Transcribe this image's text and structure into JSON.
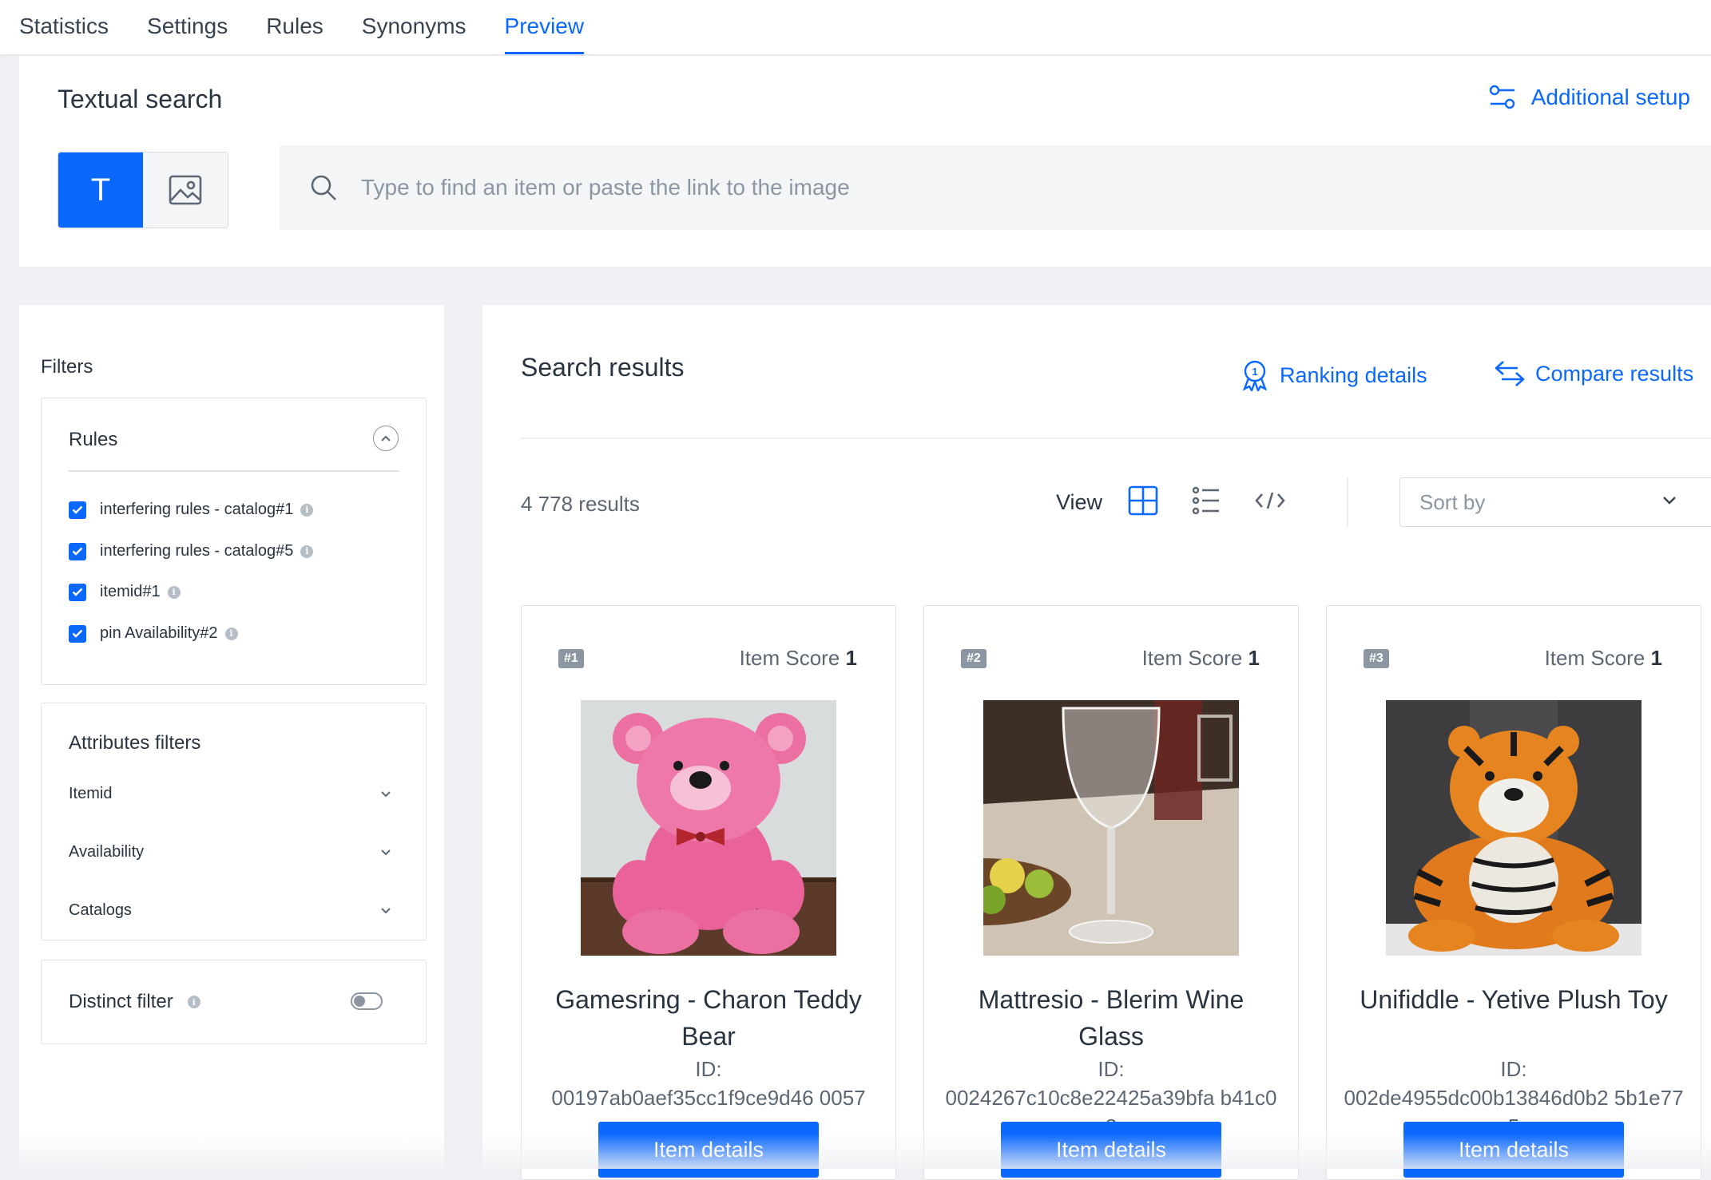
{
  "tabs": [
    {
      "label": "Statistics"
    },
    {
      "label": "Settings"
    },
    {
      "label": "Rules"
    },
    {
      "label": "Synonyms"
    },
    {
      "label": "Preview"
    }
  ],
  "active_tab": "Preview",
  "search": {
    "title": "Textual search",
    "additional_setup": "Additional setup",
    "text_mode_label": "T",
    "placeholder": "Type to find an item or paste the link to the image"
  },
  "filters": {
    "heading": "Filters",
    "rules": {
      "label": "Rules",
      "items": [
        {
          "label": "interfering rules - catalog#1",
          "checked": true
        },
        {
          "label": "interfering rules - catalog#5",
          "checked": true
        },
        {
          "label": "itemid#1",
          "checked": true
        },
        {
          "label": "pin Availability#2",
          "checked": true
        }
      ]
    },
    "attributes": {
      "label": "Attributes filters",
      "items": [
        {
          "label": "Itemid"
        },
        {
          "label": "Availability"
        },
        {
          "label": "Catalogs"
        }
      ]
    },
    "distinct": {
      "label": "Distinct filter",
      "enabled": false
    }
  },
  "results": {
    "title": "Search results",
    "ranking_details": "Ranking details",
    "compare_results": "Compare results",
    "count": "4 778 results",
    "view_label": "View",
    "sort_placeholder": "Sort by",
    "score_label": "Item Score",
    "id_label": "ID:",
    "details_button": "Item details",
    "items": [
      {
        "rank": "#1",
        "score": "1",
        "name": "Gamesring - Charon Teddy Bear",
        "id": "00197ab0aef35cc1f9ce9d46 0057"
      },
      {
        "rank": "#2",
        "score": "1",
        "name": "Mattresio - Blerim Wine Glass",
        "id": "0024267c10c8e22425a39bfa b41c02"
      },
      {
        "rank": "#3",
        "score": "1",
        "name": "Unifiddle - Yetive Plush Toy",
        "id": "002de4955dc00b13846d0b2 5b1e775"
      }
    ]
  },
  "colors": {
    "accent": "#0b68ff",
    "text": "#2a3440",
    "muted": "#8c96a3"
  }
}
